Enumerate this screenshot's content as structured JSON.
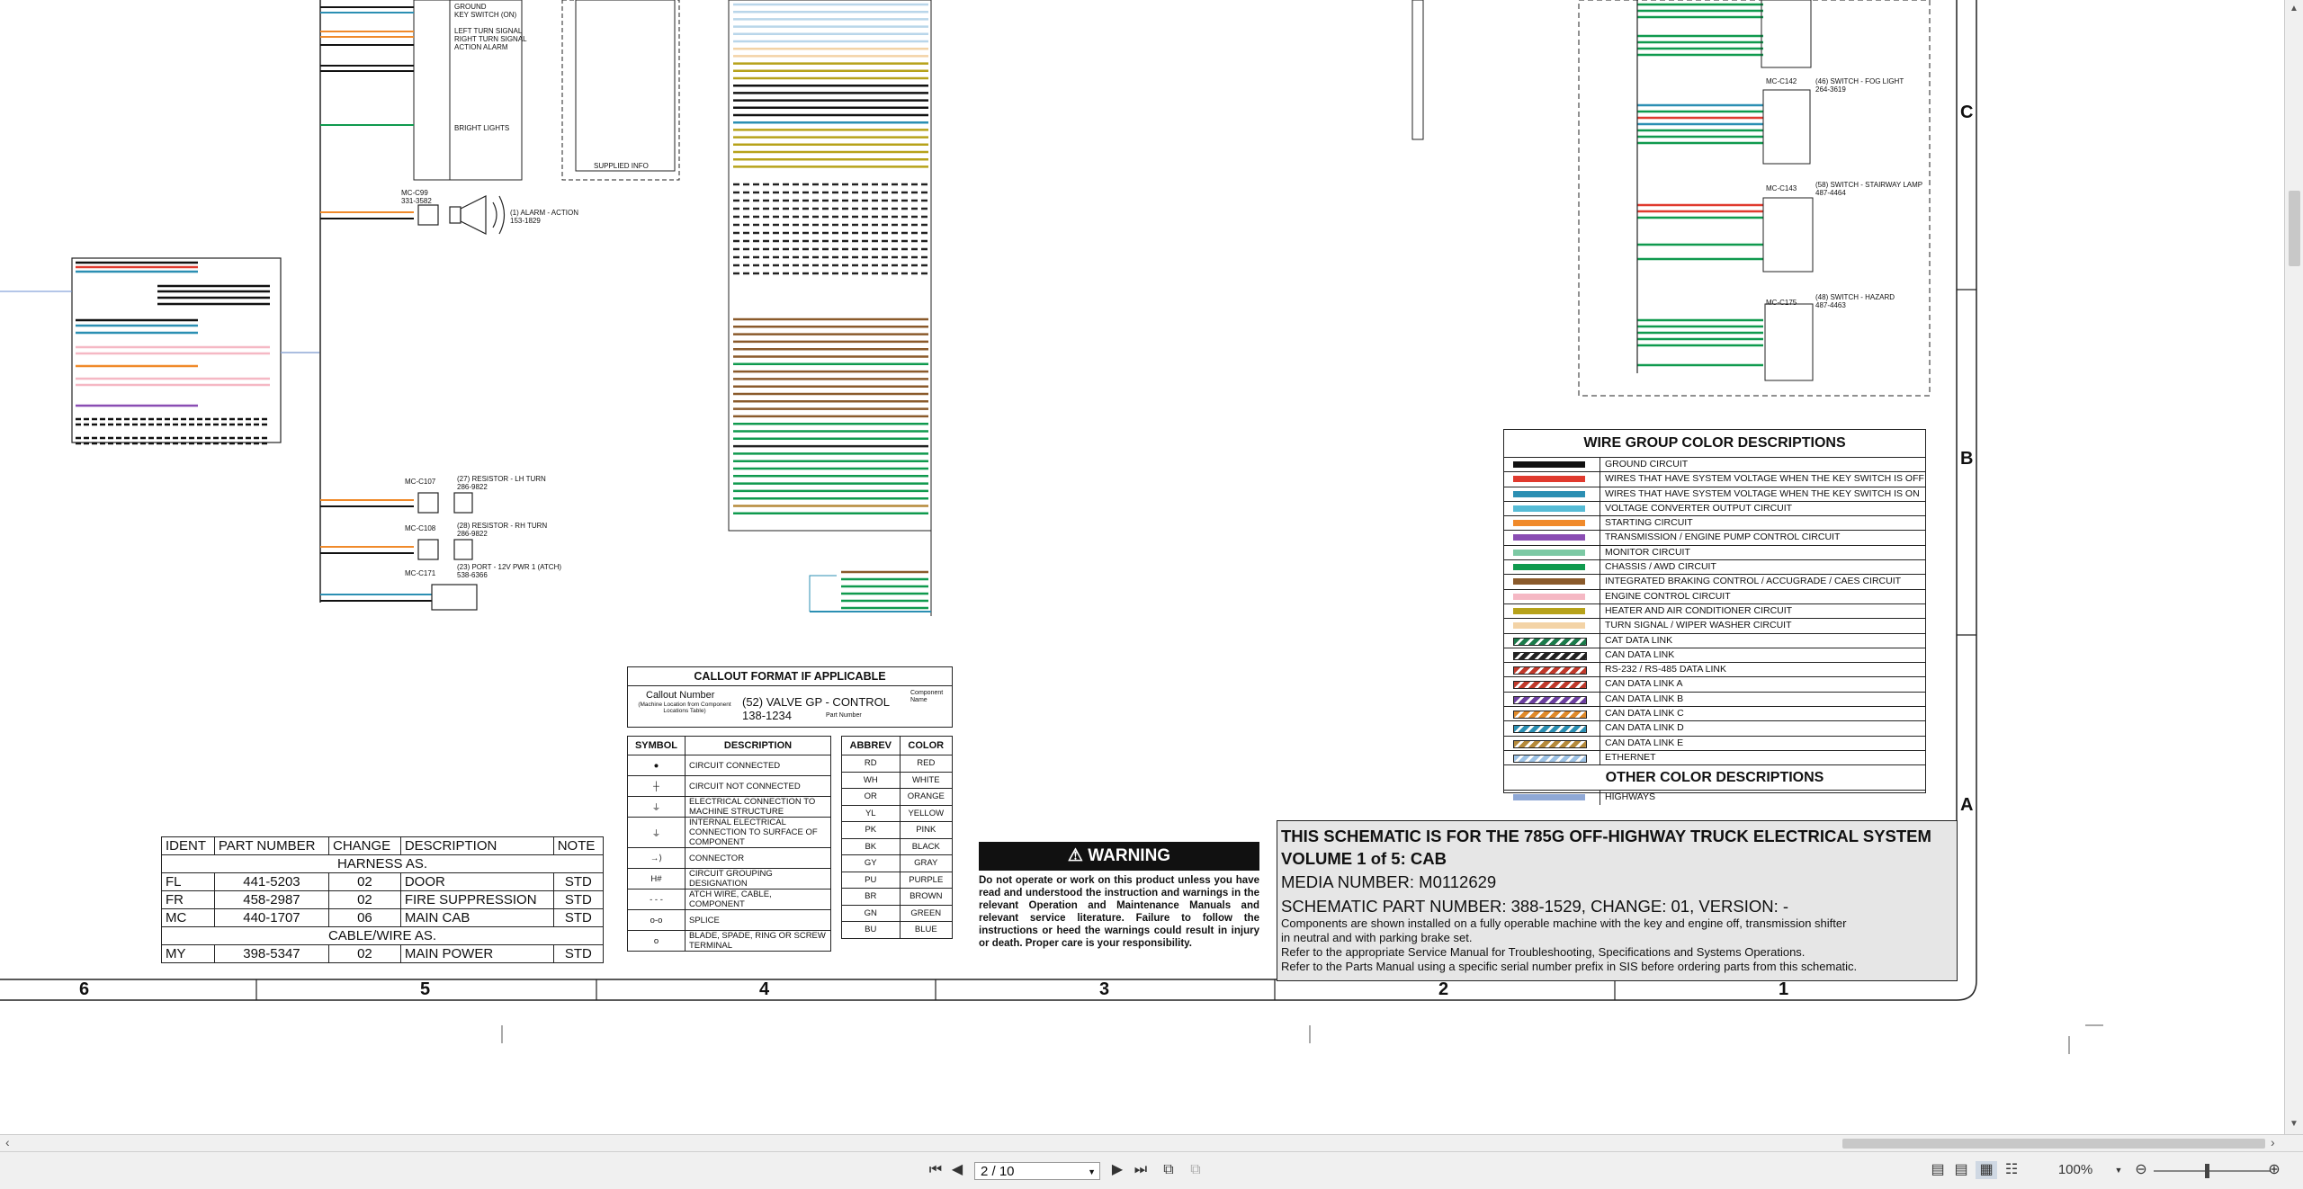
{
  "parts_table": {
    "headers": [
      "IDENT",
      "PART NUMBER",
      "CHANGE",
      "DESCRIPTION",
      "NOTE"
    ],
    "section_harness": "HARNESS AS.",
    "harness_rows": [
      {
        "ident": "FL",
        "part": "441-5203",
        "change": "02",
        "desc": "DOOR",
        "note": "STD"
      },
      {
        "ident": "FR",
        "part": "458-2987",
        "change": "02",
        "desc": "FIRE SUPPRESSION",
        "note": "STD"
      },
      {
        "ident": "MC",
        "part": "440-1707",
        "change": "06",
        "desc": "MAIN CAB",
        "note": "STD"
      }
    ],
    "section_cable": "CABLE/WIRE AS.",
    "cable_rows": [
      {
        "ident": "MY",
        "part": "398-5347",
        "change": "02",
        "desc": "MAIN POWER",
        "note": "STD"
      }
    ]
  },
  "callout": {
    "title": "CALLOUT FORMAT IF APPLICABLE",
    "callout_number_label": "Callout Number",
    "callout_sub": "(Machine Location from Component Locations Table)",
    "example_line1": "(52) VALVE GP - CONTROL",
    "example_line2": "138-1234",
    "component_name_label": "Component Name",
    "part_number_label": "Part Number"
  },
  "symbols_table": {
    "headers": [
      "SYMBOL",
      "DESCRIPTION"
    ],
    "rows": [
      {
        "sym": "●",
        "desc": "CIRCUIT CONNECTED"
      },
      {
        "sym": "┼",
        "desc": "CIRCUIT NOT CONNECTED"
      },
      {
        "sym": "⏚",
        "desc": "ELECTRICAL CONNECTION TO MACHINE STRUCTURE"
      },
      {
        "sym": "⏚",
        "desc": "INTERNAL ELECTRICAL CONNECTION TO SURFACE OF COMPONENT"
      },
      {
        "sym": "→⟩",
        "desc": "CONNECTOR"
      },
      {
        "sym": "H#",
        "desc": "CIRCUIT GROUPING DESIGNATION"
      },
      {
        "sym": "- - -",
        "desc": "ATCH WIRE, CABLE, COMPONENT"
      },
      {
        "sym": "o-o",
        "desc": "SPLICE"
      },
      {
        "sym": "o",
        "desc": "BLADE, SPADE, RING OR SCREW TERMINAL"
      }
    ]
  },
  "abbrev_table": {
    "headers": [
      "ABBREV",
      "COLOR"
    ],
    "rows": [
      [
        "RD",
        "RED"
      ],
      [
        "WH",
        "WHITE"
      ],
      [
        "OR",
        "ORANGE"
      ],
      [
        "YL",
        "YELLOW"
      ],
      [
        "PK",
        "PINK"
      ],
      [
        "BK",
        "BLACK"
      ],
      [
        "GY",
        "GRAY"
      ],
      [
        "PU",
        "PURPLE"
      ],
      [
        "BR",
        "BROWN"
      ],
      [
        "GN",
        "GREEN"
      ],
      [
        "BU",
        "BLUE"
      ]
    ]
  },
  "warning": {
    "title": "WARNING",
    "text": "Do not operate or work on this product unless you have read and understood the instruction and warnings in the relevant Operation and Maintenance Manuals and relevant service literature. Failure to follow the instructions or heed the warnings could result in injury or death. Proper care is your responsibility."
  },
  "wire_colors": {
    "title": "WIRE GROUP COLOR DESCRIPTIONS",
    "rows": [
      {
        "label": "GROUND CIRCUIT",
        "color": "#111111",
        "style": "solid"
      },
      {
        "label": "WIRES THAT HAVE SYSTEM VOLTAGE WHEN THE KEY SWITCH IS OFF",
        "color": "#e03a2e",
        "style": "solid"
      },
      {
        "label": "WIRES THAT HAVE SYSTEM VOLTAGE WHEN THE KEY SWITCH IS ON",
        "color": "#2b8fb3",
        "style": "solid"
      },
      {
        "label": "VOLTAGE CONVERTER OUTPUT CIRCUIT",
        "color": "#56bcd6",
        "style": "solid"
      },
      {
        "label": "STARTING CIRCUIT",
        "color": "#f08a2a",
        "style": "solid"
      },
      {
        "label": "TRANSMISSION / ENGINE PUMP CONTROL CIRCUIT",
        "color": "#8a4db3",
        "style": "solid"
      },
      {
        "label": "MONITOR CIRCUIT",
        "color": "#7cc9a4",
        "style": "solid"
      },
      {
        "label": "CHASSIS / AWD CIRCUIT",
        "color": "#0f9a4e",
        "style": "solid"
      },
      {
        "label": "INTEGRATED BRAKING CONTROL / ACCUGRADE / CAES CIRCUIT",
        "color": "#8a5a2b",
        "style": "solid"
      },
      {
        "label": "ENGINE CONTROL CIRCUIT",
        "color": "#f5b8c4",
        "style": "solid"
      },
      {
        "label": "HEATER AND AIR CONDITIONER CIRCUIT",
        "color": "#b7a21a",
        "style": "solid"
      },
      {
        "label": "TURN SIGNAL / WIPER WASHER CIRCUIT",
        "color": "#f3d3a6",
        "style": "solid"
      },
      {
        "label": "CAT DATA LINK",
        "color": "#1a7a4a",
        "style": "stripe"
      },
      {
        "label": "CAN DATA LINK",
        "color": "#222222",
        "style": "stripe"
      },
      {
        "label": "RS-232 / RS-485 DATA LINK",
        "color": "#c0392b",
        "style": "stripe"
      },
      {
        "label": "CAN DATA LINK A",
        "color": "#c0392b",
        "style": "stripe"
      },
      {
        "label": "CAN DATA LINK B",
        "color": "#6c3fa0",
        "style": "stripe"
      },
      {
        "label": "CAN DATA LINK C",
        "color": "#e08a2a",
        "style": "stripe"
      },
      {
        "label": "CAN DATA LINK D",
        "color": "#2b8fb3",
        "style": "stripe"
      },
      {
        "label": "CAN DATA LINK E",
        "color": "#b58a3a",
        "style": "stripe"
      },
      {
        "label": "ETHERNET",
        "color": "#9ec3e6",
        "style": "stripe"
      }
    ],
    "other_title": "OTHER COLOR DESCRIPTIONS",
    "other_rows": [
      {
        "label": "HIGHWAYS",
        "color": "#8fa8d6",
        "style": "solid"
      }
    ]
  },
  "title_block": {
    "line1": "THIS SCHEMATIC IS FOR THE 785G OFF-HIGHWAY TRUCK ELECTRICAL SYSTEM",
    "line2": "VOLUME 1 of 5: CAB",
    "line3": "MEDIA NUMBER: M0112629",
    "line4": "SCHEMATIC PART NUMBER: 388-1529, CHANGE: 01, VERSION: -",
    "line5": "Components are shown installed on a fully operable machine with the key and engine off, transmission shifter",
    "line6": "in neutral and with parking brake set.",
    "line7": "Refer to the appropriate Service Manual for Troubleshooting, Specifications and Systems Operations.",
    "line8": "Refer to the Parts Manual using a specific serial number prefix in SIS before ordering parts from this schematic."
  },
  "zones_x": [
    "6",
    "5",
    "4",
    "3",
    "2",
    "1"
  ],
  "zones_y": [
    "C",
    "B",
    "A"
  ],
  "schematic_labels": {
    "alarm": "(1) ALARM - ACTION",
    "alarm_pn": "153-1829",
    "resistor_lh": "(27) RESISTOR - LH TURN",
    "resistor_lh_pn": "286-9822",
    "resistor_rh": "(28) RESISTOR - RH TURN",
    "resistor_rh_pn": "286-9822",
    "port": "(23) PORT - 12V PWR 1 (ATCH)",
    "port_pn": "538-6366",
    "fog": "(46) SWITCH - FOG LIGHT",
    "fog_pn": "264-3619",
    "stairway": "(58) SWITCH - STAIRWAY LAMP",
    "stairway_pn": "487-4464",
    "hazard": "(48) SWITCH - HAZARD",
    "hazard_pn": "487-4463",
    "mc_c99": "MC-C99",
    "mc_c99_pn": "331-3582",
    "mc_c107": "MC-C107",
    "mc_c108": "MC-C108",
    "mc_c171": "MC-C171",
    "mc_c142": "MC-C142",
    "mc_c143": "MC-C143",
    "mc_c175": "MC-C175",
    "bright_lights": "BRIGHT LIGHTS",
    "left_turn": "LEFT TURN SIGNAL",
    "right_turn": "RIGHT TURN SIGNAL",
    "action_alarm": "ACTION ALARM",
    "ground": "GROUND",
    "key_switch": "KEY SWITCH (ON)",
    "supplied_info": "SUPPLIED INFO"
  },
  "viewer": {
    "page_value": "2 / 10",
    "zoom": "100%"
  }
}
